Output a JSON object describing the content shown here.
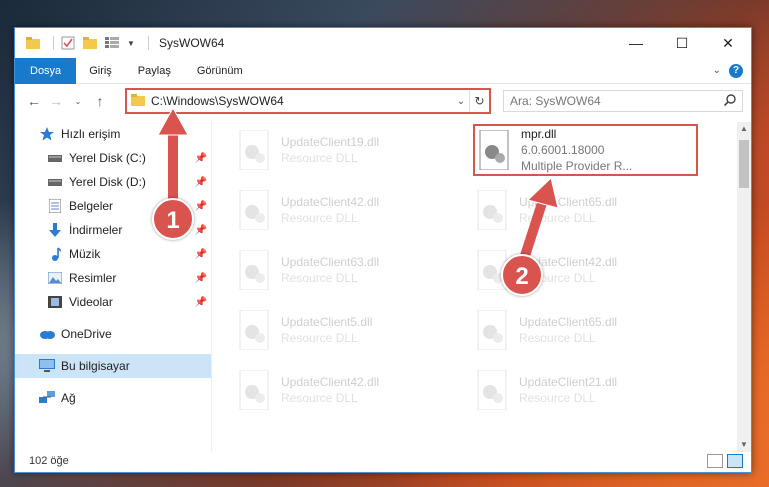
{
  "window": {
    "title": "SysWOW64"
  },
  "window_controls": {
    "minimize": "—",
    "maximize": "☐",
    "close": "✕"
  },
  "ribbon": {
    "tabs": [
      "Dosya",
      "Giriş",
      "Paylaş",
      "Görünüm"
    ]
  },
  "address": {
    "path": "C:\\Windows\\SysWOW64"
  },
  "search": {
    "placeholder": "Ara: SysWOW64"
  },
  "sidebar": {
    "items": [
      {
        "label": "Hızlı erişim",
        "icon": "star-icon"
      },
      {
        "label": "Yerel Disk (C:)",
        "icon": "drive-icon",
        "pinned": true
      },
      {
        "label": "Yerel Disk (D:)",
        "icon": "drive-icon",
        "pinned": true
      },
      {
        "label": "Belgeler",
        "icon": "document-icon",
        "pinned": true
      },
      {
        "label": "İndirmeler",
        "icon": "download-icon",
        "pinned": true
      },
      {
        "label": "Müzik",
        "icon": "music-icon",
        "pinned": true
      },
      {
        "label": "Resimler",
        "icon": "pictures-icon",
        "pinned": true
      },
      {
        "label": "Videolar",
        "icon": "video-icon",
        "pinned": true
      },
      {
        "label": "OneDrive",
        "icon": "cloud-icon"
      },
      {
        "label": "Bu bilgisayar",
        "icon": "computer-icon",
        "selected": true
      },
      {
        "label": "Ağ",
        "icon": "network-icon"
      }
    ]
  },
  "files": {
    "left": [
      {
        "name": "UpdateClient19.dll",
        "type": "Resource DLL"
      },
      {
        "name": "UpdateClient42.dll",
        "type": "Resource DLL"
      },
      {
        "name": "UpdateClient63.dll",
        "type": "Resource DLL"
      },
      {
        "name": "UpdateClient5.dll",
        "type": "Resource DLL"
      },
      {
        "name": "UpdateClient42.dll",
        "type": "Resource DLL"
      }
    ],
    "right": [
      {
        "name": "mpr.dll",
        "version": "6.0.6001.18000",
        "desc": "Multiple Provider R..."
      },
      {
        "name": "UpdateClient65.dll",
        "type": "Resource DLL"
      },
      {
        "name": "UpdateClient42.dll",
        "type": "Resource DLL"
      },
      {
        "name": "UpdateClient65.dll",
        "type": "Resource DLL"
      },
      {
        "name": "UpdateClient21.dll",
        "type": "Resource DLL"
      }
    ]
  },
  "status": {
    "count": "102 öğe"
  },
  "callouts": [
    "1",
    "2"
  ],
  "colors": {
    "accent": "#1979ca",
    "highlight": "#d9534f"
  }
}
